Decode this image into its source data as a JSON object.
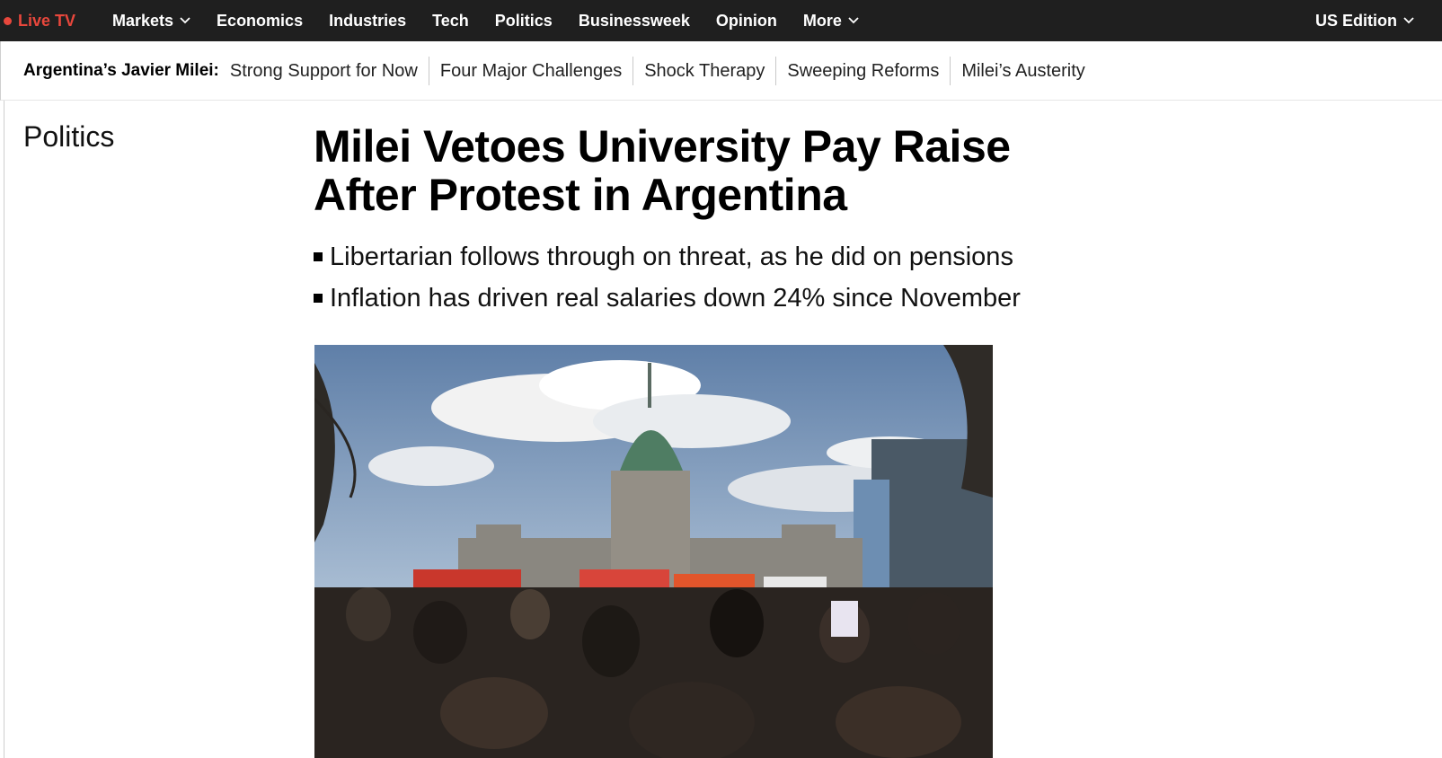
{
  "topnav": {
    "live_label": "Live TV",
    "items": [
      {
        "label": "Markets",
        "dropdown": true
      },
      {
        "label": "Economics"
      },
      {
        "label": "Industries"
      },
      {
        "label": "Tech"
      },
      {
        "label": "Politics"
      },
      {
        "label": "Businessweek"
      },
      {
        "label": "Opinion"
      },
      {
        "label": "More",
        "dropdown": true
      }
    ],
    "edition_label": "US Edition"
  },
  "subnav": {
    "title": "Argentina’s Javier Milei:",
    "links": [
      "Strong Support for Now",
      "Four Major Challenges",
      "Shock Therapy",
      "Sweeping Reforms",
      "Milei’s Austerity"
    ]
  },
  "article": {
    "section": "Politics",
    "headline": "Milei Vetoes University Pay Raise After Protest in Argentina",
    "bullets": [
      "Libertarian follows through on threat, as he did on pensions",
      "Inflation has driven real salaries down 24% since November"
    ]
  },
  "colors": {
    "nav_bg": "#1f1f1f",
    "live_red": "#e8473c"
  }
}
